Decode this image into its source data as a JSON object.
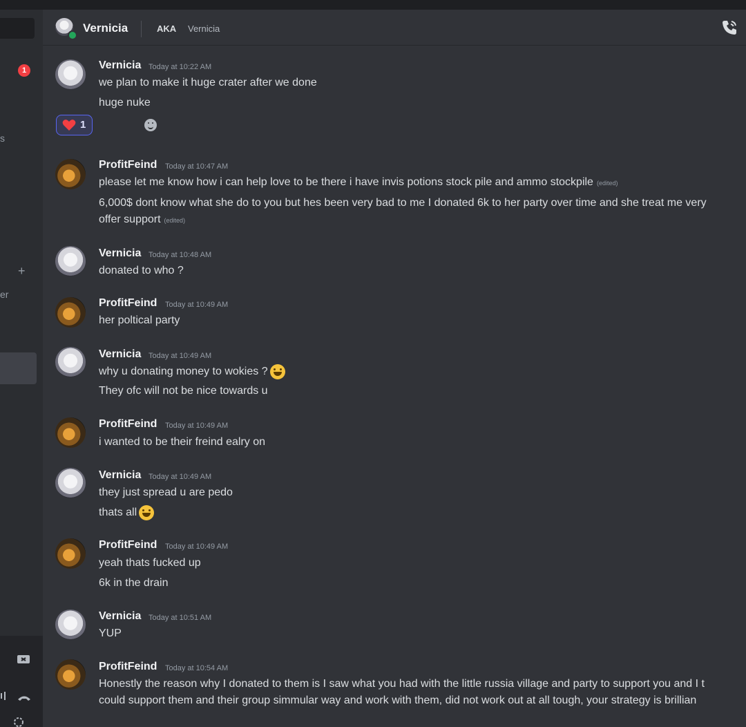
{
  "header": {
    "name": "Vernicia",
    "aka_label": "AKA",
    "alias": "Vernicia"
  },
  "sidebar": {
    "badge_count": "1",
    "fragment_1": "s",
    "fragment_2": "er"
  },
  "reaction": {
    "emoji": "heart",
    "count": "1"
  },
  "colors": {
    "accent": "#5865f2",
    "online": "#23a55a",
    "badge": "#f23f43",
    "background": "#313338"
  },
  "messages": [
    {
      "author": "Vernicia",
      "time": "Today at 10:22 AM",
      "lines": [
        "we plan to make it huge crater after we done",
        "huge nuke"
      ]
    },
    {
      "author": "ProfitFeind",
      "time": "Today at 10:47 AM",
      "lines": [
        "please let me know how i can help love to be there i have invis potions stock pile and ammo stockpile",
        "6,000$ dont know what she do to you but hes been very bad to me I donated 6k to her party over time and she treat me very",
        "offer support"
      ],
      "edited": "(edited)"
    },
    {
      "author": "Vernicia",
      "time": "Today at 10:48 AM",
      "lines": [
        "donated to who ?"
      ]
    },
    {
      "author": "ProfitFeind",
      "time": "Today at 10:49 AM",
      "lines": [
        "her poltical party"
      ]
    },
    {
      "author": "Vernicia",
      "time": "Today at 10:49 AM",
      "lines": [
        "why u donating money to wokies ?",
        "They ofc will not be nice towards u"
      ]
    },
    {
      "author": "ProfitFeind",
      "time": "Today at 10:49 AM",
      "lines": [
        "i wanted to be their freind ealry  on"
      ]
    },
    {
      "author": "Vernicia",
      "time": "Today at 10:49 AM",
      "lines": [
        "they just spread u are pedo",
        "thats all"
      ]
    },
    {
      "author": "ProfitFeind",
      "time": "Today at 10:49 AM",
      "lines": [
        "yeah thats fucked up",
        "6k in the drain"
      ]
    },
    {
      "author": "Vernicia",
      "time": "Today at 10:51 AM",
      "lines": [
        "YUP"
      ]
    },
    {
      "author": "ProfitFeind",
      "time": "Today at 10:54 AM",
      "lines": [
        "Honestly the reason why I donated to them is I saw what you had with the little russia village and party to support you and I t",
        "could support them and their group simmular way and work with them, did not work out at all tough, your strategy is brillian"
      ]
    }
  ]
}
